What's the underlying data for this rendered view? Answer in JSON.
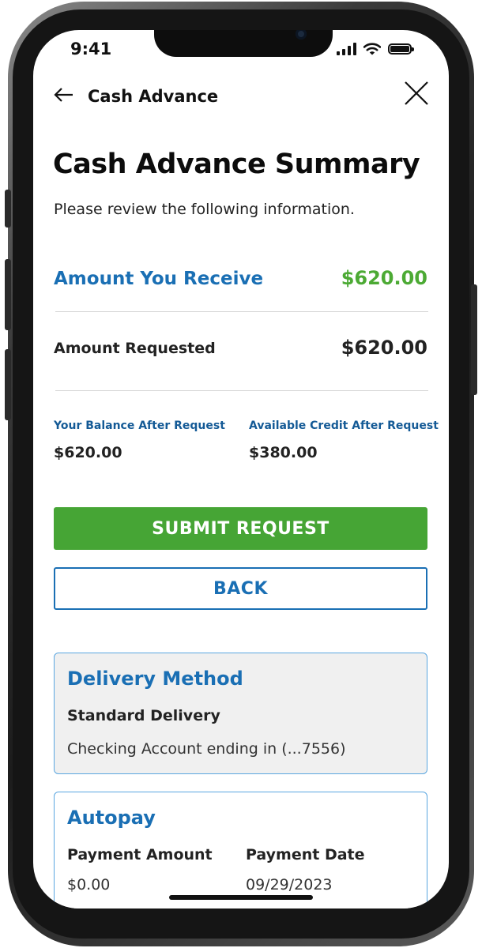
{
  "status_bar": {
    "time": "9:41"
  },
  "header": {
    "title": "Cash Advance"
  },
  "page": {
    "title": "Cash Advance Summary",
    "subtitle": "Please review the following information."
  },
  "summary": {
    "receive_label": "Amount You Receive",
    "receive_value": "$620.00",
    "requested_label": "Amount Requested",
    "requested_value": "$620.00",
    "balance_label": "Your Balance After Request",
    "balance_value": "$620.00",
    "credit_label": "Available Credit After Request",
    "credit_value": "$380.00"
  },
  "actions": {
    "submit_label": "SUBMIT REQUEST",
    "back_label": "BACK"
  },
  "delivery": {
    "title": "Delivery Method",
    "method": "Standard Delivery",
    "account": "Checking Account ending in (...7556)"
  },
  "autopay": {
    "title": "Autopay",
    "amount_label": "Payment Amount",
    "amount_value": "$0.00",
    "date_label": "Payment Date",
    "date_value": "09/29/2023"
  },
  "colors": {
    "primary_blue": "#1a6fb4",
    "accent_green": "#46a535",
    "amount_green": "#4caa34"
  },
  "icons": {
    "back": "arrow-left-icon",
    "close": "close-icon",
    "signal": "cellular-signal-icon",
    "wifi": "wifi-icon",
    "battery": "battery-icon"
  }
}
